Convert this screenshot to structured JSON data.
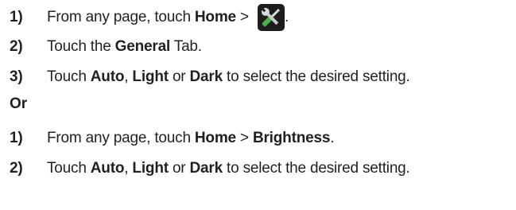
{
  "group1": {
    "steps": [
      {
        "number": "1)",
        "prefix": "From any page, touch ",
        "bold1": "Home",
        "separator": " > ",
        "icon": "tools-icon",
        "suffix": "."
      },
      {
        "number": "2)",
        "prefix": "Touch the ",
        "bold1": "General",
        "suffix": " Tab."
      },
      {
        "number": "3)",
        "prefix": "Touch ",
        "bold1": "Auto",
        "sep1": ", ",
        "bold2": "Light",
        "sep2": " or ",
        "bold3": "Dark",
        "suffix": " to select the desired setting."
      }
    ]
  },
  "or_label": "Or",
  "group2": {
    "steps": [
      {
        "number": "1)",
        "prefix": "From any page, touch ",
        "bold1": "Home",
        "separator": " > ",
        "bold2": "Brightness",
        "suffix": "."
      },
      {
        "number": "2)",
        "prefix": "Touch ",
        "bold1": "Auto",
        "sep1": ", ",
        "bold2": "Light",
        "sep2": " or ",
        "bold3": "Dark",
        "suffix": " to select the desired setting."
      }
    ]
  },
  "colors": {
    "text": "#231f20",
    "icon_bg": "#1d1d1d",
    "icon_green": "#3fb549",
    "icon_silver": "#d9d9d9"
  }
}
